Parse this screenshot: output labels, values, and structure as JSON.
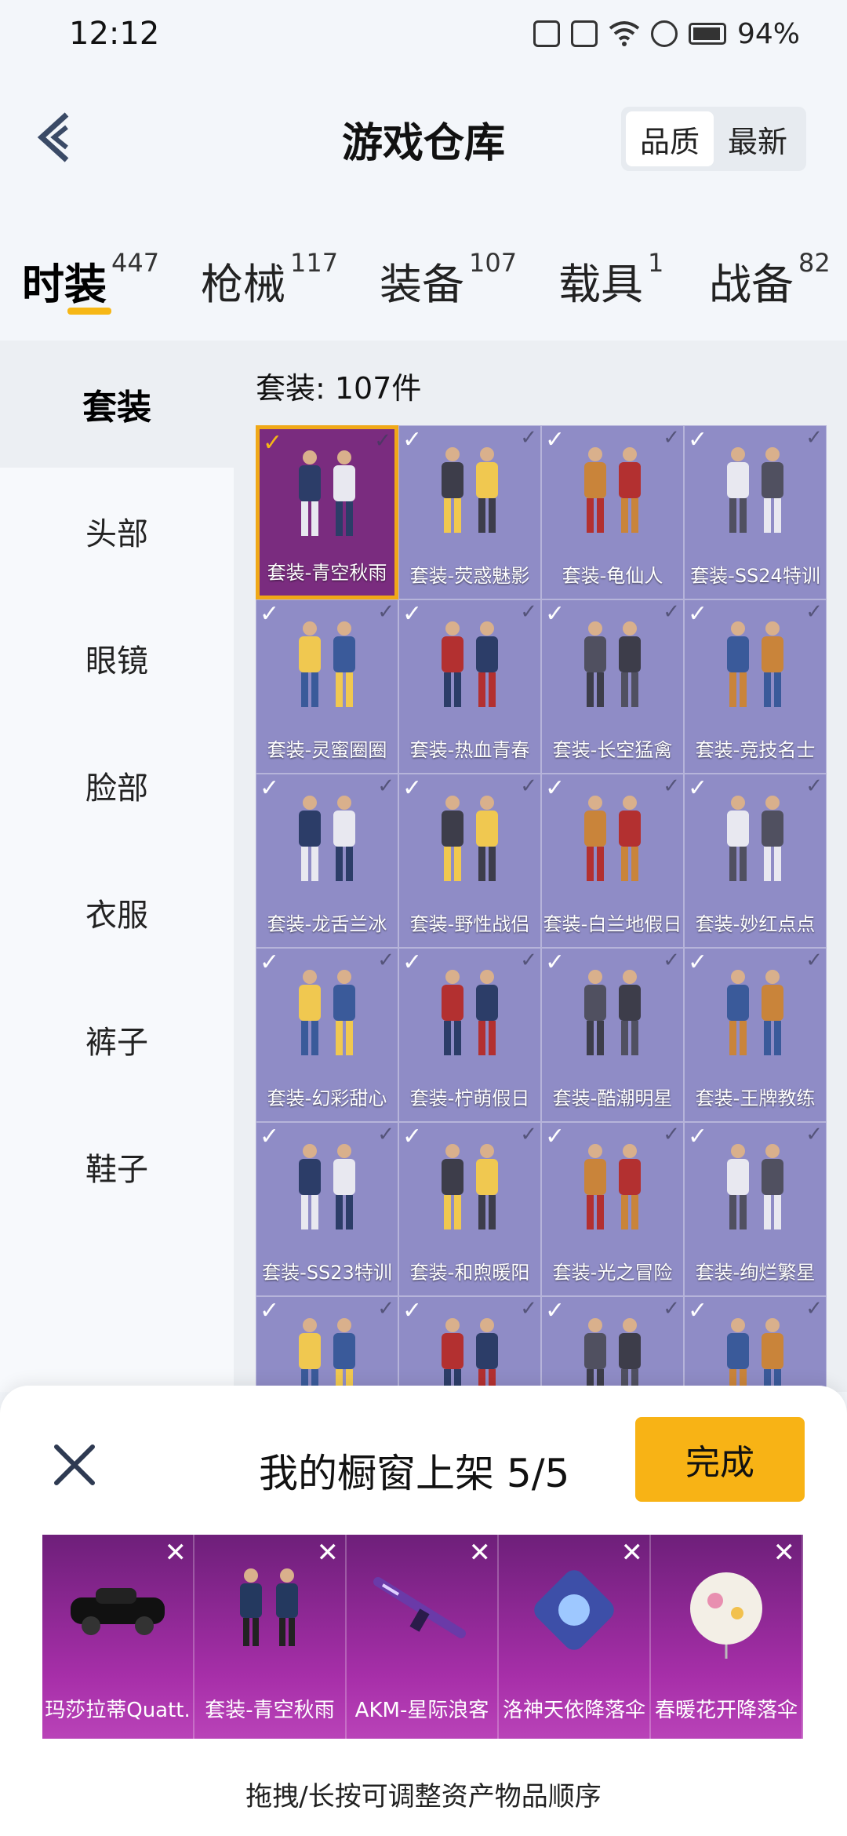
{
  "status_bar": {
    "time": "12:12",
    "battery": "94%"
  },
  "header": {
    "title": "游戏仓库",
    "sort_options": [
      "品质",
      "最新"
    ]
  },
  "tabs": [
    {
      "label": "时装",
      "count": "447"
    },
    {
      "label": "枪械",
      "count": "117"
    },
    {
      "label": "装备",
      "count": "107"
    },
    {
      "label": "载具",
      "count": "1"
    },
    {
      "label": "战备",
      "count": "82"
    }
  ],
  "side_nav": [
    "套装",
    "头部",
    "眼镜",
    "脸部",
    "衣服",
    "裤子",
    "鞋子"
  ],
  "count_line": "套装: 107件",
  "items": [
    "套装-青空秋雨",
    "套装-荧惑魅影",
    "套装-龟仙人",
    "套装-SS24特训",
    "套装-灵蜜圈圈",
    "套装-热血青春",
    "套装-长空猛禽",
    "套装-竞技名士",
    "套装-龙舌兰冰",
    "套装-野性战侣",
    "套装-白兰地假日",
    "套装-妙红点点",
    "套装-幻彩甜心",
    "套装-柠萌假日",
    "套装-酷潮明星",
    "套装-王牌教练",
    "套装-SS23特训",
    "套装-和煦暖阳",
    "套装-光之冒险",
    "套装-绚烂繁星",
    "",
    "",
    "",
    ""
  ],
  "sheet": {
    "title": "我的橱窗上架 5/5",
    "done_label": "完成",
    "hint": "拖拽/长按可调整资产物品顺序",
    "showcase": [
      "玛莎拉蒂Quatt.",
      "套装-青空秋雨",
      "AKM-星际浪客",
      "洛神天依降落伞",
      "春暖花开降落伞"
    ]
  }
}
